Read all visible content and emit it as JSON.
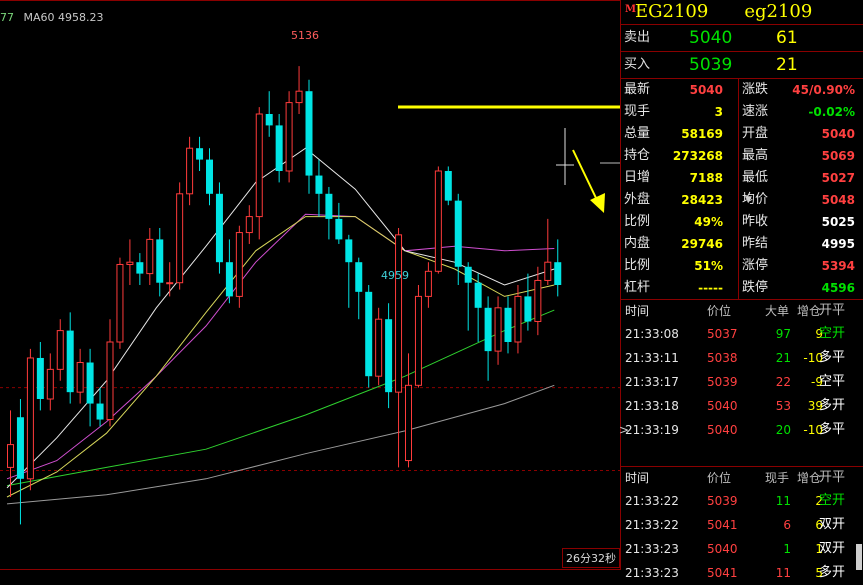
{
  "chart": {
    "ma_cut": "77",
    "ma60_label": "MA60 4958.23",
    "high_label": "5136",
    "low_label": "4959",
    "time_left": "26分32秒"
  },
  "chart_data": {
    "type": "candlestick",
    "candles": [
      [
        4960,
        4970,
        4985,
        4947
      ],
      [
        4982,
        4955,
        4990,
        4935
      ],
      [
        4955,
        5008,
        5012,
        4950
      ],
      [
        5008,
        4990,
        5015,
        4985
      ],
      [
        4990,
        5003,
        5010,
        4985
      ],
      [
        5003,
        5020,
        5025,
        4998
      ],
      [
        5020,
        4993,
        5028,
        4988
      ],
      [
        4993,
        5006,
        5012,
        4988
      ],
      [
        5006,
        4988,
        5012,
        4978
      ],
      [
        4988,
        4981,
        4995,
        4978
      ],
      [
        4981,
        5015,
        5025,
        4978
      ],
      [
        5015,
        5049,
        5052,
        5012
      ],
      [
        5049,
        5050,
        5060,
        5040
      ],
      [
        5050,
        5045,
        5054,
        5040
      ],
      [
        5045,
        5060,
        5065,
        5040
      ],
      [
        5060,
        5041,
        5065,
        5035
      ],
      [
        5041,
        5041,
        5050,
        5035
      ],
      [
        5041,
        5080,
        5085,
        5038
      ],
      [
        5080,
        5100,
        5105,
        5075
      ],
      [
        5100,
        5095,
        5105,
        5090
      ],
      [
        5095,
        5080,
        5100,
        5075
      ],
      [
        5080,
        5050,
        5085,
        5045
      ],
      [
        5050,
        5035,
        5060,
        5032
      ],
      [
        5035,
        5063,
        5066,
        5030
      ],
      [
        5063,
        5070,
        5075,
        5058
      ],
      [
        5070,
        5115,
        5118,
        5060
      ],
      [
        5115,
        5110,
        5125,
        5105
      ],
      [
        5110,
        5090,
        5115,
        5085
      ],
      [
        5090,
        5120,
        5125,
        5085
      ],
      [
        5120,
        5125,
        5136,
        5115
      ],
      [
        5125,
        5088,
        5130,
        5080
      ],
      [
        5088,
        5080,
        5095,
        5070
      ],
      [
        5080,
        5069,
        5083,
        5060
      ],
      [
        5069,
        5060,
        5076,
        5058
      ],
      [
        5060,
        5050,
        5062,
        5030
      ],
      [
        5050,
        5037,
        5052,
        5025
      ],
      [
        5037,
        5000,
        5040,
        4995
      ],
      [
        5000,
        5025,
        5030,
        4996
      ],
      [
        5025,
        4993,
        5032,
        4986
      ],
      [
        4993,
        5062,
        5065,
        4960
      ],
      [
        4963,
        4996,
        5010,
        4960
      ],
      [
        4996,
        5035,
        5040,
        4995
      ],
      [
        5035,
        5046,
        5050,
        5030
      ],
      [
        5046,
        5090,
        5092,
        5045
      ],
      [
        5090,
        5077,
        5092,
        5075
      ],
      [
        5077,
        5048,
        5080,
        5040
      ],
      [
        5048,
        5041,
        5050,
        5020
      ],
      [
        5041,
        5030,
        5045,
        5015
      ],
      [
        5030,
        5011,
        5035,
        4998
      ],
      [
        5011,
        5030,
        5035,
        5005
      ],
      [
        5030,
        5015,
        5035,
        5010
      ],
      [
        5015,
        5035,
        5040,
        5010
      ],
      [
        5035,
        5024,
        5045,
        5020
      ],
      [
        5024,
        5042,
        5048,
        5018
      ],
      [
        5042,
        5050,
        5069,
        5040
      ],
      [
        5050,
        5040,
        5060,
        5035
      ]
    ],
    "ma_fast": [
      [
        0,
        4951
      ],
      [
        5,
        4973
      ],
      [
        10,
        4998
      ],
      [
        15,
        5030
      ],
      [
        20,
        5057
      ],
      [
        25,
        5085
      ],
      [
        30,
        5100
      ],
      [
        35,
        5082
      ],
      [
        40,
        5055
      ],
      [
        45,
        5050
      ],
      [
        50,
        5040
      ],
      [
        55,
        5047
      ]
    ],
    "ma_mid": [
      [
        0,
        4947
      ],
      [
        5,
        4958
      ],
      [
        10,
        4975
      ],
      [
        15,
        5000
      ],
      [
        20,
        5028
      ],
      [
        25,
        5055
      ],
      [
        30,
        5070
      ],
      [
        35,
        5070
      ],
      [
        40,
        5055
      ],
      [
        45,
        5047
      ],
      [
        50,
        5035
      ],
      [
        55,
        5040
      ]
    ],
    "ma_long": [
      [
        0,
        4955
      ],
      [
        5,
        4963
      ],
      [
        10,
        4980
      ],
      [
        15,
        5000
      ],
      [
        20,
        5022
      ],
      [
        25,
        5050
      ],
      [
        30,
        5071
      ],
      [
        35,
        5070
      ],
      [
        40,
        5055
      ],
      [
        45,
        5057
      ],
      [
        50,
        5055
      ],
      [
        55,
        5056
      ]
    ],
    "ma_green": [
      [
        0,
        4952
      ],
      [
        10,
        4960
      ],
      [
        20,
        4968
      ],
      [
        30,
        4983
      ],
      [
        40,
        5000
      ],
      [
        50,
        5020
      ],
      [
        55,
        5029
      ]
    ],
    "ma_gray": [
      [
        0,
        4944
      ],
      [
        10,
        4948
      ],
      [
        20,
        4955
      ],
      [
        30,
        4966
      ],
      [
        40,
        4976
      ],
      [
        50,
        4988
      ],
      [
        55,
        4996
      ]
    ],
    "ylim": [
      4915,
      5165
    ],
    "ref_price": 4995
  },
  "quote": {
    "code": "EG2109",
    "name": "eg2109",
    "ask_label": "卖出",
    "ask_price": "5040",
    "ask_vol": "61",
    "bid_label": "买入",
    "bid_price": "5039",
    "bid_vol": "21",
    "stats": [
      {
        "l": "最新",
        "v": "5040",
        "c": "red",
        "l2": "涨跌",
        "v2": "45/0.90%",
        "c2": "red"
      },
      {
        "l": "现手",
        "v": "3",
        "c": "yellow",
        "l2": "速涨",
        "v2": "-0.02%",
        "c2": "green"
      },
      {
        "l": "总量",
        "v": "58169",
        "c": "yellow",
        "l2": "开盘",
        "v2": "5040",
        "c2": "red"
      },
      {
        "l": "持仓",
        "v": "273268",
        "c": "yellow",
        "l2": "最高",
        "v2": "5069",
        "c2": "red"
      },
      {
        "l": "日增",
        "v": "7188",
        "c": "yellow",
        "l2": "最低",
        "v2": "5027",
        "c2": "red"
      },
      {
        "l": "外盘",
        "v": "28423",
        "c": "yellow",
        "l2": "均价",
        "v2": "5048",
        "c2": "red"
      },
      {
        "l": "比例",
        "v": "49%",
        "c": "yellow",
        "l2": "昨收",
        "v2": "5025",
        "c2": "white"
      },
      {
        "l": "内盘",
        "v": "29746",
        "c": "yellow",
        "l2": "昨结",
        "v2": "4995",
        "c2": "white"
      },
      {
        "l": "比例",
        "v": "51%",
        "c": "yellow",
        "l2": "涨停",
        "v2": "5394",
        "c2": "red"
      },
      {
        "l": "杠杆",
        "v": "-----",
        "c": "yellow",
        "l2": "跌停",
        "v2": "4596",
        "c2": "green"
      }
    ],
    "trades1_head": [
      "时间",
      "价位",
      "大单",
      "增仓",
      "开平"
    ],
    "trades1": [
      {
        "t": "21:33:08",
        "p": "5037",
        "q": "97",
        "d": "9",
        "k": "空开"
      },
      {
        "t": "21:33:11",
        "p": "5038",
        "q": "21",
        "d": "-10",
        "k": "多平"
      },
      {
        "t": "21:33:17",
        "p": "5039",
        "q": "22",
        "d": "-9",
        "k": "空平"
      },
      {
        "t": "21:33:18",
        "p": "5040",
        "q": "53",
        "d": "39",
        "k": "多开"
      },
      {
        "t": "21:33:19",
        "p": "5040",
        "q": "20",
        "d": "-10",
        "k": "多平"
      }
    ],
    "pointer_char": ">",
    "trades2_head": [
      "时间",
      "价位",
      "现手",
      "增仓",
      "开平"
    ],
    "trades2": [
      {
        "t": "21:33:22",
        "p": "5039",
        "q": "11",
        "d": "2",
        "k": "空开"
      },
      {
        "t": "21:33:22",
        "p": "5041",
        "q": "6",
        "d": "6",
        "k": "双开"
      },
      {
        "t": "21:33:23",
        "p": "5040",
        "q": "1",
        "d": "1",
        "k": "双开"
      },
      {
        "t": "21:33:23",
        "p": "5041",
        "q": "11",
        "d": "5",
        "k": "多开"
      }
    ],
    "colors": {
      "up": "#ff3b3b",
      "down": "#00e5e5",
      "buy_green": "#00e000",
      "highlight": "#ffff00",
      "border": "#8a0000"
    }
  }
}
